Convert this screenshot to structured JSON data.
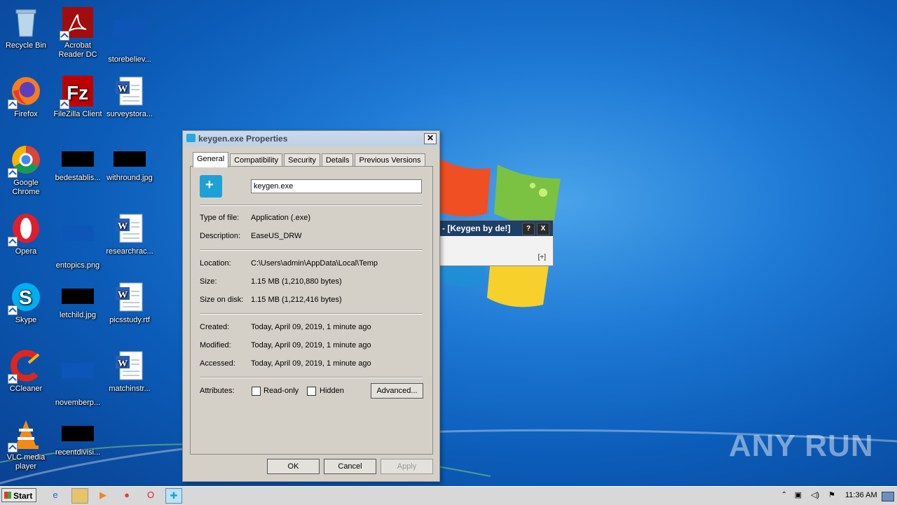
{
  "desktop": {
    "icons": [
      {
        "label": "Recycle Bin"
      },
      {
        "label": "Acrobat Reader DC"
      },
      {
        "label": "storebeliev..."
      },
      {
        "label": "Firefox"
      },
      {
        "label": "FileZilla Client"
      },
      {
        "label": "surveystora..."
      },
      {
        "label": "Google Chrome"
      },
      {
        "label": "bedestablis..."
      },
      {
        "label": "withround.jpg"
      },
      {
        "label": "Opera"
      },
      {
        "label": "entopics.png"
      },
      {
        "label": "researchrac..."
      },
      {
        "label": "Skype"
      },
      {
        "label": "letchild.jpg"
      },
      {
        "label": "picsstudy.rtf"
      },
      {
        "label": "CCleaner"
      },
      {
        "label": "novemberp..."
      },
      {
        "label": "matchinstr..."
      },
      {
        "label": "VLC media player"
      },
      {
        "label": "recentdivisi..."
      }
    ],
    "watermark": "ANY RUN"
  },
  "keygen_window": {
    "title": "2 - [Keygen  by de!]",
    "help_btn": "?",
    "close_btn": "X",
    "expand": "[+]"
  },
  "dialog": {
    "title": "keygen.exe Properties",
    "close": "✕",
    "tabs": [
      "General",
      "Compatibility",
      "Security",
      "Details",
      "Previous Versions"
    ],
    "filename": "keygen.exe",
    "type_label": "Type of file:",
    "type_value": "Application (.exe)",
    "desc_label": "Description:",
    "desc_value": "EaseUS_DRW",
    "location_label": "Location:",
    "location_value": "C:\\Users\\admin\\AppData\\Local\\Temp",
    "size_label": "Size:",
    "size_value": "1.15 MB (1,210,880 bytes)",
    "sizedisk_label": "Size on disk:",
    "sizedisk_value": "1.15 MB (1,212,416 bytes)",
    "created_label": "Created:",
    "created_value": "Today, April 09, 2019, 1 minute ago",
    "modified_label": "Modified:",
    "modified_value": "Today, April 09, 2019, 1 minute ago",
    "accessed_label": "Accessed:",
    "accessed_value": "Today, April 09, 2019, 1 minute ago",
    "attributes_label": "Attributes:",
    "readonly_label": "Read-only",
    "hidden_label": "Hidden",
    "advanced_btn": "Advanced...",
    "ok_btn": "OK",
    "cancel_btn": "Cancel",
    "apply_btn": "Apply"
  },
  "taskbar": {
    "start_label": "Start",
    "clock": "11:36 AM"
  }
}
